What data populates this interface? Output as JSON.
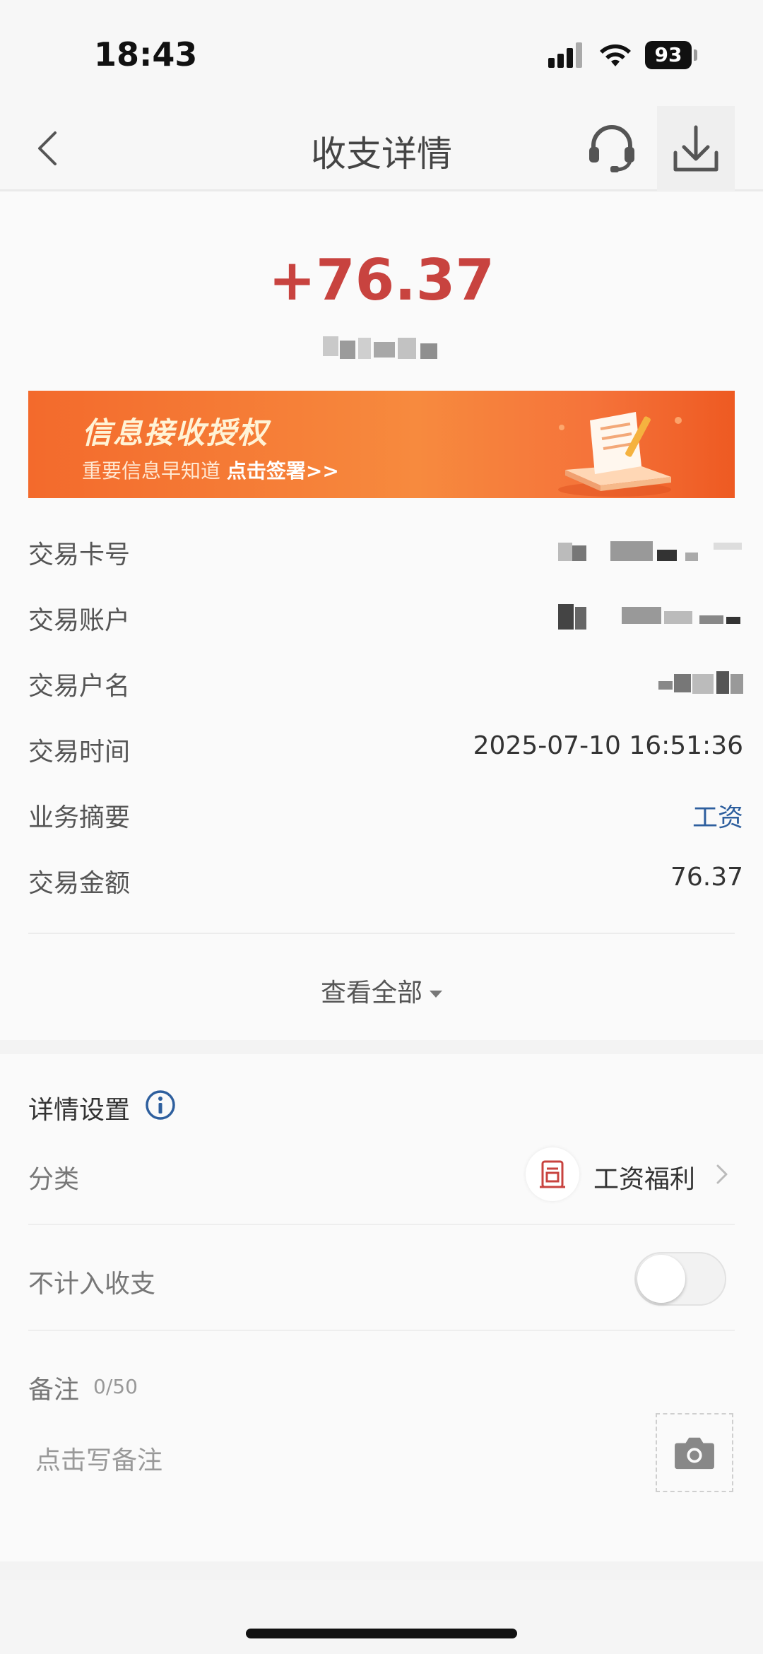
{
  "status_bar": {
    "time": "18:43",
    "battery": "93"
  },
  "nav": {
    "title": "收支详情"
  },
  "transaction": {
    "amount": "+76.37",
    "amount_color": "#c8433f"
  },
  "banner": {
    "title": "信息接收授权",
    "subtitle": "重要信息早知道 ",
    "cta": "点击签署>>"
  },
  "details": {
    "rows": [
      {
        "label": "交易卡号",
        "value": ""
      },
      {
        "label": "交易账户",
        "value": ""
      },
      {
        "label": "交易户名",
        "value": ""
      },
      {
        "label": "交易时间",
        "value": "2025-07-10 16:51:36"
      },
      {
        "label": "业务摘要",
        "value": "工资"
      },
      {
        "label": "交易金额",
        "value": "76.37"
      }
    ],
    "view_all": "查看全部"
  },
  "settings": {
    "title": "详情设置",
    "category_label": "分类",
    "category_value": "工资福利",
    "exclude_label": "不计入收支",
    "exclude_enabled": false,
    "note_label": "备注",
    "note_count": "0/50",
    "note_placeholder": "点击写备注"
  },
  "colors": {
    "accent_red": "#c8433f",
    "link_blue": "#2e5f9e",
    "banner_orange": "#f36a2c"
  }
}
